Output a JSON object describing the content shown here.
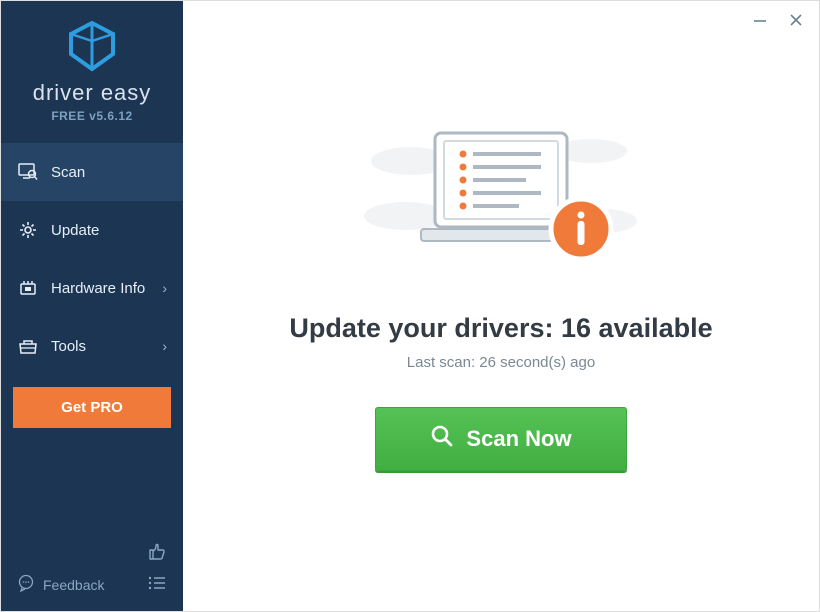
{
  "brand": {
    "name": "driver easy",
    "version": "FREE v5.6.12"
  },
  "sidebar": {
    "items": [
      {
        "label": "Scan"
      },
      {
        "label": "Update"
      },
      {
        "label": "Hardware Info"
      },
      {
        "label": "Tools"
      }
    ],
    "get_pro": "Get PRO",
    "feedback": "Feedback"
  },
  "main": {
    "headline_prefix": "Update your drivers: ",
    "available_count": "16",
    "headline_suffix": " available",
    "last_scan": "Last scan: 26 second(s) ago",
    "scan_button": "Scan Now"
  },
  "colors": {
    "accent_orange": "#f07a3a",
    "accent_green": "#49b849",
    "sidebar_bg": "#1c3553"
  }
}
